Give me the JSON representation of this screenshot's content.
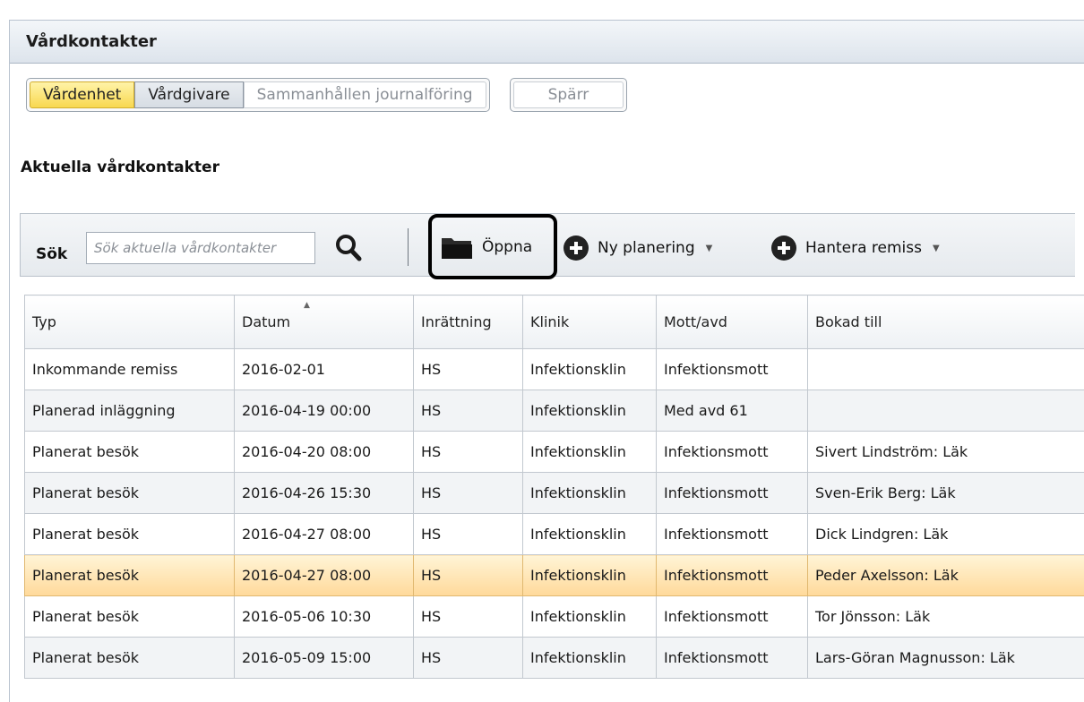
{
  "window": {
    "title": "Vårdkontakter"
  },
  "tabs": {
    "vardenhet": "Vårdenhet",
    "vardgivare": "Vårdgivare",
    "sammanhallen": "Sammanhållen journalföring",
    "sparr": "Spärr"
  },
  "section": {
    "title": "Aktuella vårdkontakter"
  },
  "toolbar": {
    "sok_label": "Sök",
    "search_placeholder": "Sök aktuella vårdkontakter",
    "open_label": "Öppna",
    "ny_planering_label": "Ny planering",
    "hantera_remiss_label": "Hantera remiss"
  },
  "table": {
    "columns": [
      "Typ",
      "Datum",
      "Inrättning",
      "Klinik",
      "Mott/avd",
      "Bokad till"
    ],
    "rows": [
      [
        "Inkommande remiss",
        "2016-02-01",
        "HS",
        "Infektionsklin",
        "Infektionsmott",
        ""
      ],
      [
        "Planerad inläggning",
        "2016-04-19 00:00",
        "HS",
        "Infektionsklin",
        "Med avd 61",
        ""
      ],
      [
        "Planerat besök",
        "2016-04-20 08:00",
        "HS",
        "Infektionsklin",
        "Infektionsmott",
        "Sivert Lindström: Läk"
      ],
      [
        "Planerat besök",
        "2016-04-26 15:30",
        "HS",
        "Infektionsklin",
        "Infektionsmott",
        "Sven-Erik Berg: Läk"
      ],
      [
        "Planerat besök",
        "2016-04-27 08:00",
        "HS",
        "Infektionsklin",
        "Infektionsmott",
        "Dick Lindgren: Läk"
      ],
      [
        "Planerat besök",
        "2016-04-27 08:00",
        "HS",
        "Infektionsklin",
        "Infektionsmott",
        "Peder Axelsson: Läk"
      ],
      [
        "Planerat besök",
        "2016-05-06 10:30",
        "HS",
        "Infektionsklin",
        "Infektionsmott",
        "Tor Jönsson: Läk"
      ],
      [
        "Planerat besök",
        "2016-05-09 15:00",
        "HS",
        "Infektionsklin",
        "Infektionsmott",
        "Lars-Göran Magnusson: Läk"
      ]
    ]
  },
  "colors": {
    "active_tab": "#f8d850",
    "selected_row": "#ffd99a",
    "highlight_border": "#000000"
  },
  "icons": {
    "search": "magnifier-icon",
    "open": "folder-icon",
    "add": "plus-circle-icon",
    "dropdown": "caret-down-icon"
  }
}
